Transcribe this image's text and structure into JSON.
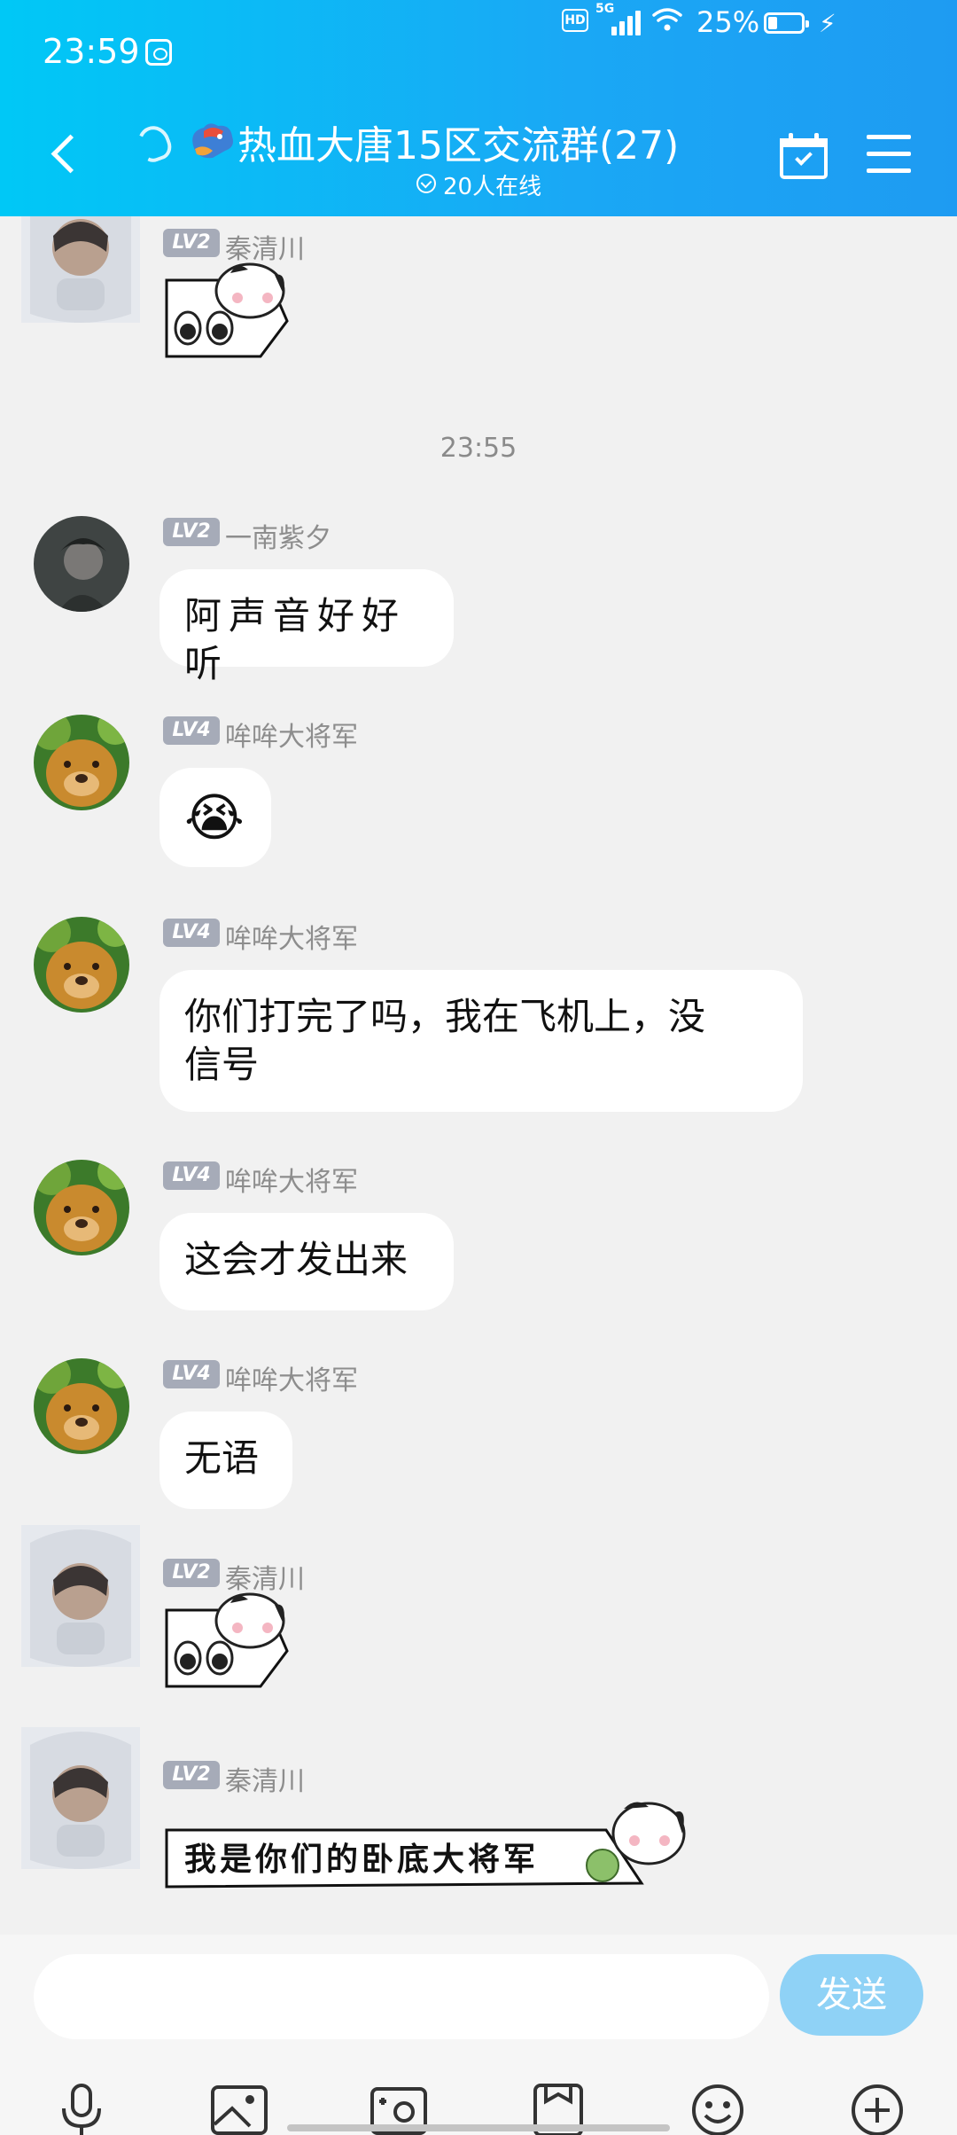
{
  "status_bar": {
    "time": "23:59",
    "network": "5G",
    "hd": "HD",
    "battery_percent": "25%"
  },
  "header": {
    "title": "热血大唐15区交流群(27)",
    "online": "20人在线"
  },
  "messages": [
    {
      "type": "sticker",
      "level": "LV2",
      "name": "秦清川",
      "sticker": "puppy-peeking-eyes"
    },
    {
      "type": "time",
      "text": "23:55"
    },
    {
      "type": "text",
      "level": "LV2",
      "name": "一南紫夕",
      "text": "阿声音好好听"
    },
    {
      "type": "emoji",
      "level": "LV4",
      "name": "哞哞大将军",
      "emoji": "😭"
    },
    {
      "type": "text",
      "level": "LV4",
      "name": "哞哞大将军",
      "text_line1": "你们打完了吗，我在飞机上，没",
      "text_line2": "信号"
    },
    {
      "type": "text",
      "level": "LV4",
      "name": "哞哞大将军",
      "text": "这会才发出来"
    },
    {
      "type": "text",
      "level": "LV4",
      "name": "哞哞大将军",
      "text": "无语"
    },
    {
      "type": "sticker",
      "level": "LV2",
      "name": "秦清川",
      "sticker": "puppy-peeking-eyes"
    },
    {
      "type": "sticker",
      "level": "LV2",
      "name": "秦清川",
      "sticker": "puppy-banner",
      "text": "我是你们的卧底大将军"
    }
  ],
  "input": {
    "placeholder": "",
    "send_label": "发送"
  },
  "toolbar": [
    "microphone-icon",
    "image-icon",
    "camera-icon",
    "file-icon",
    "emoji-icon",
    "plus-icon"
  ]
}
